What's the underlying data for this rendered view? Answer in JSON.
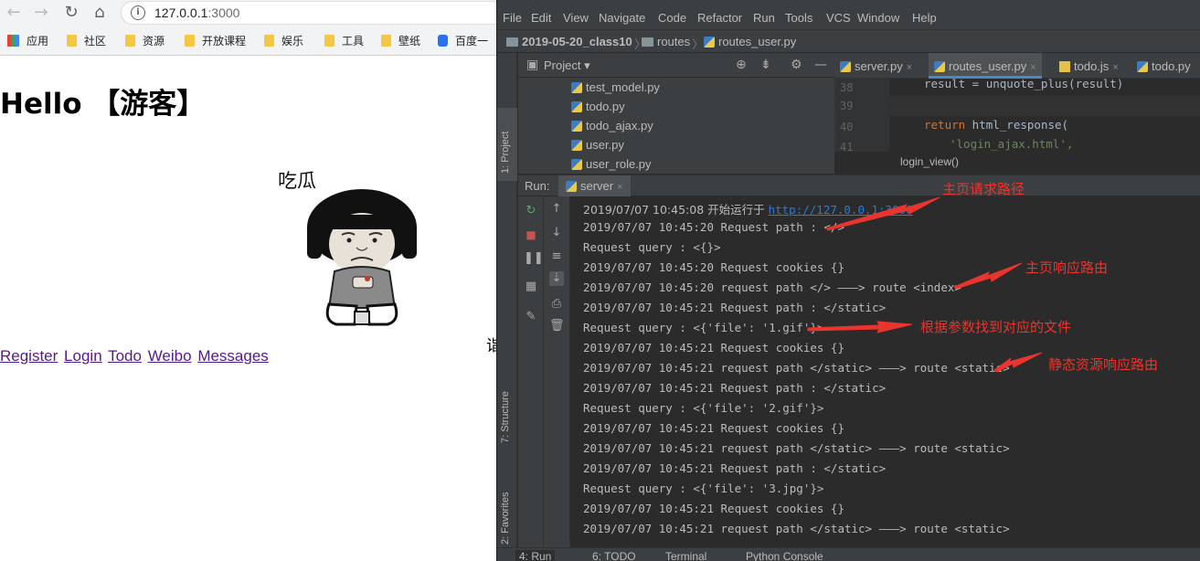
{
  "browser": {
    "nav": {
      "back": "←",
      "forward": "→",
      "reload": "↻",
      "home": "⌂"
    },
    "url_host": "127.0.0.1",
    "url_port": ":3000",
    "bookmarks": [
      "应用",
      "社区",
      "资源",
      "开放课程",
      "娱乐",
      "工具",
      "壁纸",
      "百度一"
    ],
    "heading": "Hello 【游客】",
    "meme_caption": "吃瓜",
    "clipped_char": "诣",
    "links": [
      "Register",
      "Login",
      "Todo",
      "Weibo",
      "Messages"
    ]
  },
  "ide": {
    "menu": [
      "File",
      "Edit",
      "View",
      "Navigate",
      "Code",
      "Refactor",
      "Run",
      "Tools",
      "VCS",
      "Window",
      "Help"
    ],
    "breadcrumbs": [
      "2019-05-20_class10",
      "routes",
      "routes_user.py"
    ],
    "side_tabs": {
      "project": "1: Project",
      "structure": "7: Structure",
      "favorites": "2: Favorites"
    },
    "project_panel": {
      "title": "Project",
      "files": [
        "test_model.py",
        "todo.py",
        "todo_ajax.py",
        "user.py",
        "user_role.py"
      ]
    },
    "editor_tabs": [
      "server.py",
      "routes_user.py",
      "todo.js",
      "todo.py"
    ],
    "editor": {
      "line_numbers": [
        "38",
        "39",
        "40",
        "41"
      ],
      "line38": "result = unquote_plus(result)",
      "line40_kw": "return",
      "line40_rest": " html_response(",
      "line41": "'login_ajax.html',",
      "crumb": "login_view()"
    },
    "run": {
      "label": "Run:",
      "tab": "server",
      "console": [
        "2019/07/07 10:45:08 开始运行于 ",
        "2019/07/07 10:45:20 Request path : </>",
        "Request query : <{}>",
        "2019/07/07 10:45:20 Request cookies {}",
        "2019/07/07 10:45:20 request path </> ———> route <index>",
        "2019/07/07 10:45:21 Request path : </static>",
        "Request query : <{'file': '1.gif'}>",
        "2019/07/07 10:45:21 Request cookies {}",
        "2019/07/07 10:45:21 request path </static> ———> route <static>",
        "2019/07/07 10:45:21 Request path : </static>",
        "Request query : <{'file': '2.gif'}>",
        "2019/07/07 10:45:21 Request cookies {}",
        "2019/07/07 10:45:21 request path </static> ———> route <static>",
        "2019/07/07 10:45:21 Request path : </static>",
        "Request query : <{'file': '3.jpg'}>",
        "2019/07/07 10:45:21 Request cookies {}",
        "2019/07/07 10:45:21 request path </static> ———> route <static>"
      ],
      "console_link": "http://127.0.0.1:3000"
    },
    "bottom_tabs": [
      "4: Run",
      "6: TODO",
      "Terminal",
      "Python Console"
    ]
  },
  "annotations": {
    "color": "#e8352e",
    "labels": [
      "主页请求路径",
      "主页响应路由",
      "根据参数找到对应的文件",
      "静态资源响应路由"
    ]
  }
}
